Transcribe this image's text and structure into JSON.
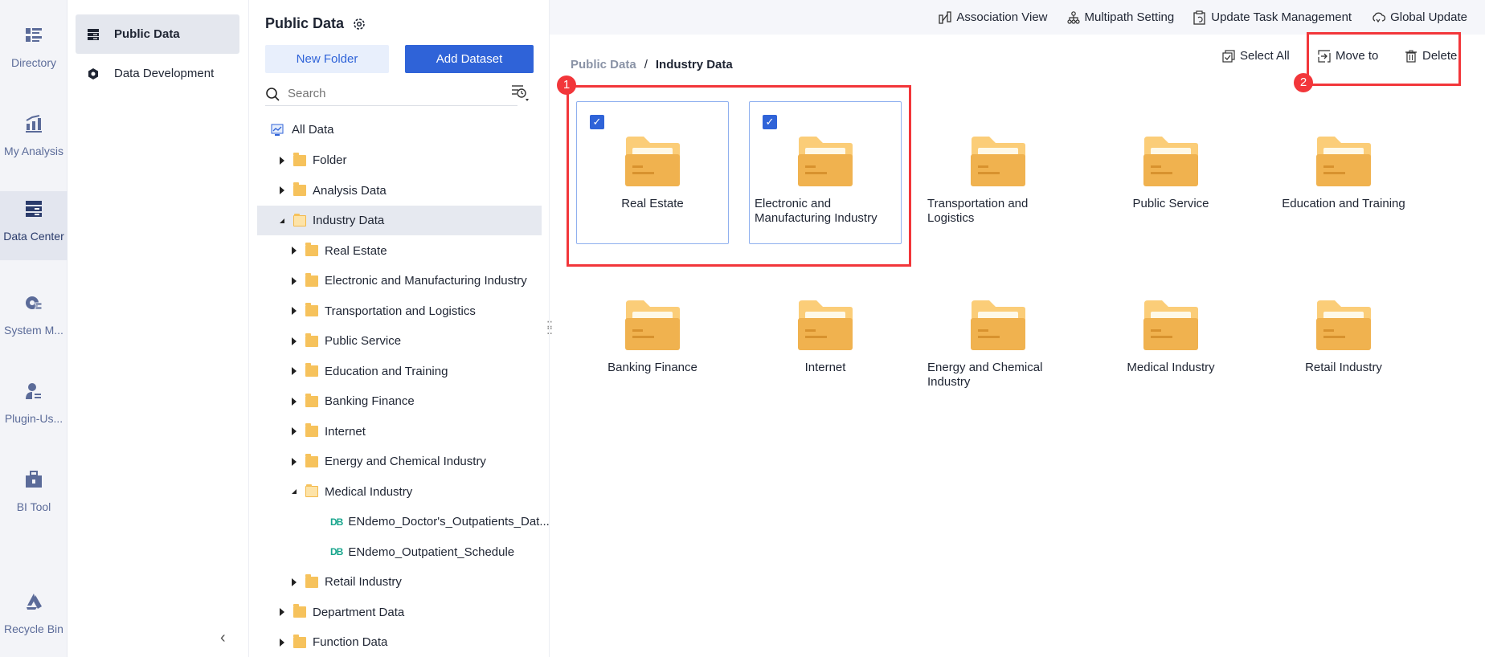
{
  "nav": [
    {
      "label": "Directory",
      "icon": "directory-icon"
    },
    {
      "label": "My Analysis",
      "icon": "analysis-icon"
    },
    {
      "label": "Data Center",
      "icon": "data-center-icon",
      "active": true
    },
    {
      "label": "System M...",
      "icon": "system-management-icon"
    },
    {
      "label": "Plugin-Us...",
      "icon": "plugin-user-icon"
    },
    {
      "label": "BI Tool",
      "icon": "toolbox-icon"
    },
    {
      "label": "Recycle Bin",
      "icon": "recycle-bin-icon"
    }
  ],
  "sub": {
    "items": [
      {
        "label": "Public Data"
      },
      {
        "label": "Data Development"
      }
    ]
  },
  "tree": {
    "title": "Public Data",
    "new_folder": "New Folder",
    "add_dataset": "Add Dataset",
    "search_placeholder": "Search",
    "root": "All Data",
    "rows": [
      {
        "label": "Folder",
        "level": 0,
        "type": "folder"
      },
      {
        "label": "Analysis Data",
        "level": 0,
        "type": "folder"
      },
      {
        "label": "Industry Data",
        "level": 0,
        "type": "folder",
        "open": true,
        "selected": true
      },
      {
        "label": "Real Estate",
        "level": 1,
        "type": "folder"
      },
      {
        "label": "Electronic and Manufacturing Industry",
        "level": 1,
        "type": "folder"
      },
      {
        "label": "Transportation and Logistics",
        "level": 1,
        "type": "folder"
      },
      {
        "label": "Public Service",
        "level": 1,
        "type": "folder"
      },
      {
        "label": "Education and Training",
        "level": 1,
        "type": "folder"
      },
      {
        "label": "Banking Finance",
        "level": 1,
        "type": "folder"
      },
      {
        "label": "Internet",
        "level": 1,
        "type": "folder"
      },
      {
        "label": "Energy and Chemical Industry",
        "level": 1,
        "type": "folder"
      },
      {
        "label": "Medical Industry",
        "level": 1,
        "type": "folder",
        "open": true
      },
      {
        "label": "ENdemo_Doctor's_Outpatients_Dat...",
        "level": 2,
        "type": "db"
      },
      {
        "label": "ENdemo_Outpatient_Schedule",
        "level": 2,
        "type": "db"
      },
      {
        "label": "Retail Industry",
        "level": 1,
        "type": "folder"
      },
      {
        "label": "Department Data",
        "level": 0,
        "type": "folder"
      },
      {
        "label": "Function Data",
        "level": 0,
        "type": "folder"
      }
    ]
  },
  "toolbar": {
    "association_view": "Association View",
    "multipath_setting": "Multipath Setting",
    "update_task": "Update Task Management",
    "global_update": "Global Update"
  },
  "breadcrumb": {
    "parent": "Public Data",
    "sep": "/",
    "current": "Industry Data"
  },
  "actions": {
    "select_all": "Select All",
    "move_to": "Move to",
    "delete": "Delete"
  },
  "annotations": {
    "badge1": "1",
    "badge2": "2"
  },
  "cards": [
    {
      "name": "Real Estate",
      "checked": true
    },
    {
      "name": "Electronic and Manufacturing Industry",
      "checked": true
    },
    {
      "name": "Transportation and Logistics"
    },
    {
      "name": "Public Service"
    },
    {
      "name": "Education and Training"
    },
    {
      "name": "Banking Finance"
    },
    {
      "name": "Internet"
    },
    {
      "name": "Energy and Chemical Industry"
    },
    {
      "name": "Medical Industry"
    },
    {
      "name": "Retail Industry"
    }
  ],
  "colors": {
    "accent": "#2f63d8",
    "annotation": "#f2363a",
    "folder": "#f0b24f"
  }
}
